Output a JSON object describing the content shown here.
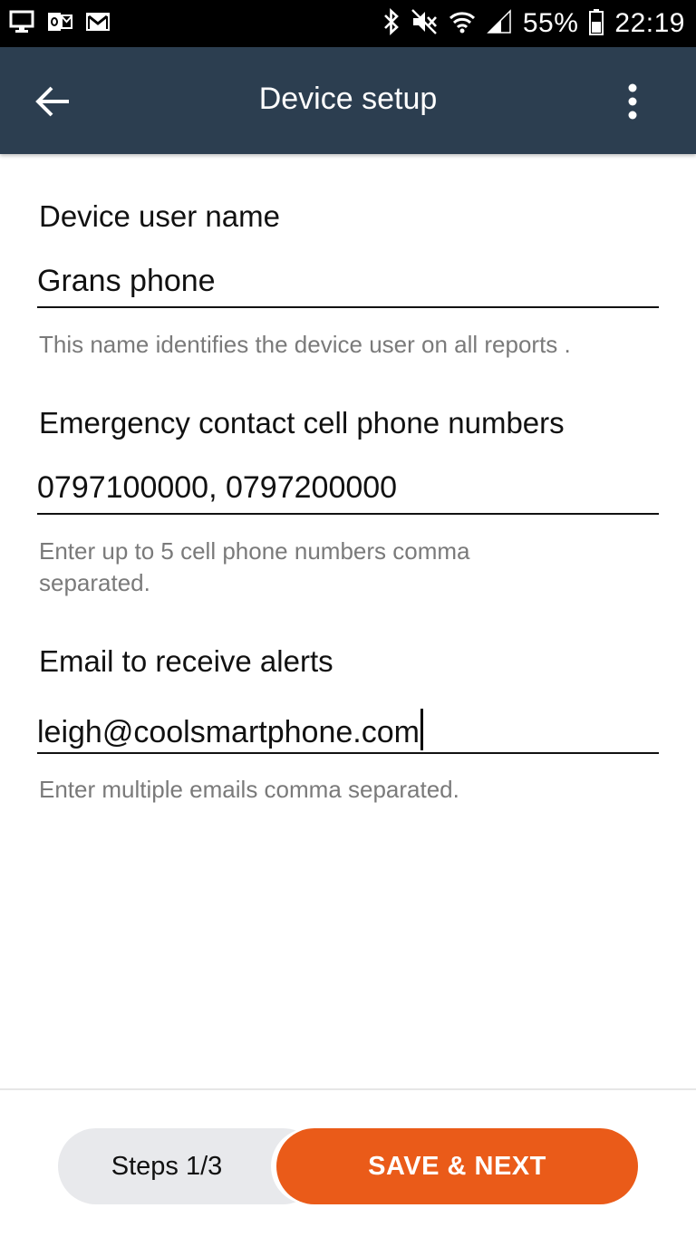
{
  "status_bar": {
    "battery_percent": "55%",
    "time": "22:19",
    "icons": [
      "display-icon",
      "outlook-icon",
      "gmail-icon",
      "bluetooth-icon",
      "mute-icon",
      "wifi-icon",
      "signal-icon",
      "battery-icon"
    ]
  },
  "app_bar": {
    "title": "Device setup",
    "back_icon": "arrow-left-icon",
    "menu_icon": "more-vertical-icon"
  },
  "form": {
    "user_name": {
      "label": "Device user name",
      "value": "Grans phone",
      "hint": "This name identifies the device user on all reports ."
    },
    "emergency": {
      "label": "Emergency contact cell phone numbers",
      "value": "0797100000, 0797200000",
      "hint": "Enter up to 5 cell phone numbers comma separated."
    },
    "email": {
      "label": "Email to receive alerts",
      "value": "leigh@coolsmartphone.com",
      "hint": "Enter multiple emails comma separated."
    }
  },
  "footer": {
    "steps": "Steps 1/3",
    "save_next": "SAVE & NEXT"
  },
  "colors": {
    "app_bar": "#2c3e50",
    "accent": "#ea5b19",
    "hint_text": "#7a7a7a"
  }
}
